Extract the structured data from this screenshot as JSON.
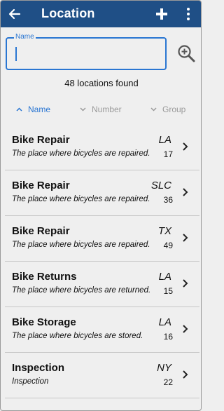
{
  "appbar": {
    "title": "Location"
  },
  "search": {
    "label": "Name",
    "value": ""
  },
  "results": {
    "count_text": "48 locations found"
  },
  "sort": [
    {
      "label": "Name",
      "active": true
    },
    {
      "label": "Number",
      "active": false
    },
    {
      "label": "Group",
      "active": false
    }
  ],
  "locations": [
    {
      "name": "Bike Repair",
      "code": "LA",
      "description": "The place where bicycles are repaired.",
      "number": "17"
    },
    {
      "name": "Bike Repair",
      "code": "SLC",
      "description": "The place where bicycles are repaired.",
      "number": "36"
    },
    {
      "name": "Bike Repair",
      "code": "TX",
      "description": "The place where bicycles are repaired.",
      "number": "49"
    },
    {
      "name": "Bike Returns",
      "code": "LA",
      "description": "The place where bicycles are returned.",
      "number": "15"
    },
    {
      "name": "Bike Storage",
      "code": "LA",
      "description": "The place where bicycles are stored.",
      "number": "16"
    },
    {
      "name": "Inspection",
      "code": "NY",
      "description": "Inspection",
      "number": "22"
    }
  ],
  "colors": {
    "appbar": "#1f4f86",
    "accent": "#2a76d2",
    "background": "#efefef",
    "muted": "#9a9a9a"
  },
  "icons": [
    "back-arrow-icon",
    "plus-icon",
    "more-vert-icon",
    "zoom-in-icon",
    "chevron-up-icon",
    "chevron-down-icon",
    "chevron-right-icon"
  ]
}
